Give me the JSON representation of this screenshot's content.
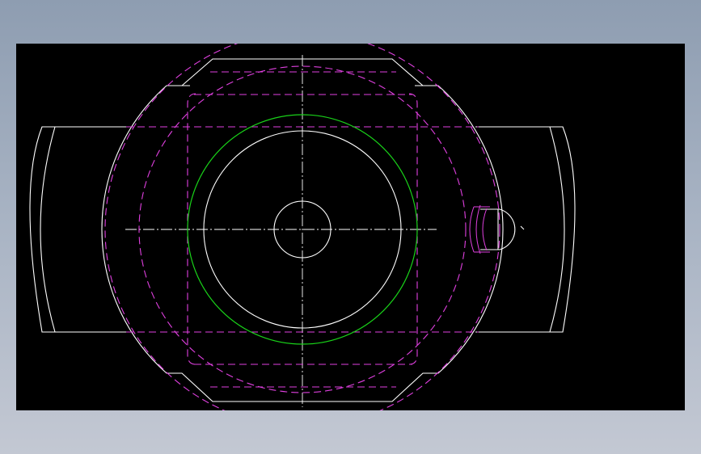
{
  "colors": {
    "background": "#000000",
    "outline": "#ffffff",
    "green_circle": "#19d219",
    "hidden_lines": "#e040e0",
    "frame_top": "#8e9db1",
    "frame_bottom": "#c3c8d3"
  }
}
